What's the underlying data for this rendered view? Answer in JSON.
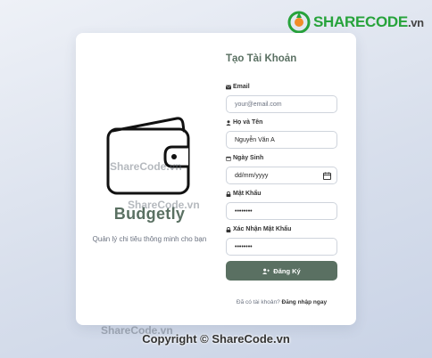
{
  "brand": {
    "name": "Budgetly",
    "tagline": "Quản lý chi tiêu thông minh cho bạn"
  },
  "form": {
    "title": "Tạo Tài Khoản",
    "email": {
      "label": "Email",
      "placeholder": "your@email.com"
    },
    "name": {
      "label": "Họ và Tên",
      "value": "Nguyễn Văn A"
    },
    "dob": {
      "label": "Ngày Sinh",
      "placeholder": "dd/mm/yyyy"
    },
    "password": {
      "label": "Mật Khẩu",
      "value": "••••••••"
    },
    "confirm": {
      "label": "Xác Nhận Mật Khẩu",
      "value": "••••••••"
    },
    "submit_label": "Đăng Ký",
    "login_prompt": "Đã có tài khoản?",
    "login_link": "Đăng nhập ngay"
  },
  "watermark": {
    "logo_main": "SHARECODE",
    "logo_suffix": ".vn",
    "copyright": "Copyright © ShareCode.vn",
    "overlay": "ShareCode.vn"
  },
  "colors": {
    "accent": "#5a7062",
    "logo_green": "#27a33b"
  }
}
